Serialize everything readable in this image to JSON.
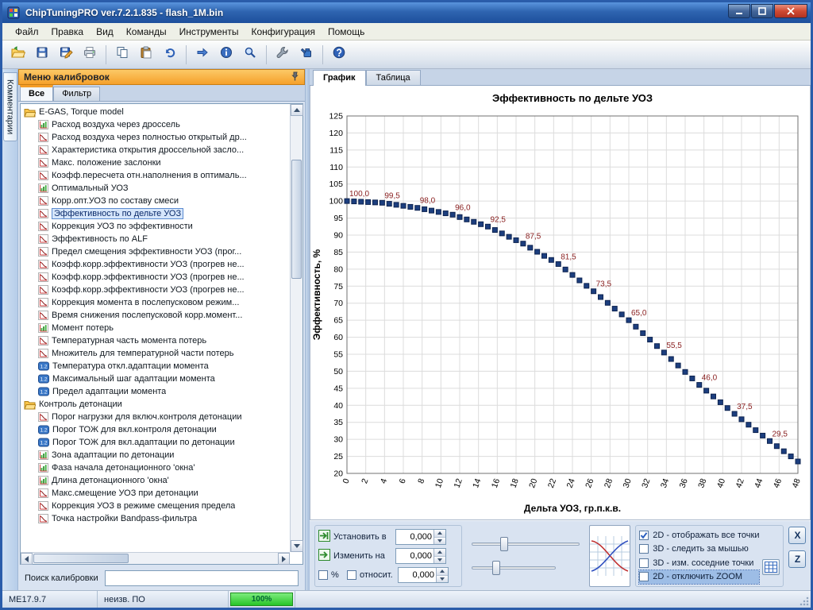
{
  "window": {
    "title": "ChipTuningPRO ver.7.2.1.835 - flash_1M.bin"
  },
  "menu": {
    "items": [
      "Файл",
      "Правка",
      "Вид",
      "Команды",
      "Инструменты",
      "Конфигурация",
      "Помощь"
    ]
  },
  "toolbar": {
    "items": [
      "open",
      "save",
      "save-edit",
      "print",
      "sep",
      "copy",
      "paste",
      "undo",
      "sep",
      "compare",
      "info",
      "search",
      "sep",
      "tools",
      "refill",
      "sep",
      "help"
    ]
  },
  "side_tab": {
    "label": "Комментарии"
  },
  "left_panel": {
    "header": "Меню калибровок",
    "tabs": [
      {
        "label": "Все",
        "active": true
      },
      {
        "label": "Фильтр",
        "active": false
      }
    ],
    "search_label": "Поиск калибровки",
    "tree": [
      {
        "label": "E-GAS, Torque model",
        "items": [
          {
            "icon": "map",
            "label": "Расход воздуха через дроссель"
          },
          {
            "icon": "curve",
            "label": "Расход воздуха через полностью открытый др..."
          },
          {
            "icon": "curve",
            "label": "Характеристика открытия дроссельной засло..."
          },
          {
            "icon": "curve",
            "label": "Макс. положение заслонки"
          },
          {
            "icon": "curve",
            "label": "Коэфф.пересчета отн.наполнения в оптималь..."
          },
          {
            "icon": "map",
            "label": "Оптимальный УОЗ"
          },
          {
            "icon": "curve",
            "label": "Корр.опт.УОЗ по составу смеси"
          },
          {
            "icon": "curve",
            "label": "Эффективность по дельте УОЗ",
            "selected": true
          },
          {
            "icon": "curve",
            "label": "Коррекция УОЗ по эффективности"
          },
          {
            "icon": "curve",
            "label": "Эффективность по ALF"
          },
          {
            "icon": "curve",
            "label": "Предел смещения эффективности УОЗ (прог..."
          },
          {
            "icon": "curve",
            "label": "Коэфф.корр.эффективности УОЗ (прогрев не..."
          },
          {
            "icon": "curve",
            "label": "Коэфф.корр.эффективности УОЗ (прогрев не..."
          },
          {
            "icon": "curve",
            "label": "Коэфф.корр.эффективности УОЗ (прогрев не..."
          },
          {
            "icon": "curve",
            "label": "Коррекция момента в послепусковом режим..."
          },
          {
            "icon": "curve",
            "label": "Время снижения послепусковой корр.момент..."
          },
          {
            "icon": "map",
            "label": "Момент потерь"
          },
          {
            "icon": "curve",
            "label": "Температурная часть момента потерь"
          },
          {
            "icon": "curve",
            "label": "Множитель для температурной части потерь"
          },
          {
            "icon": "scalar",
            "label": "Температура откл.адаптации момента"
          },
          {
            "icon": "scalar",
            "label": "Максимальный шаг адаптации момента"
          },
          {
            "icon": "scalar",
            "label": "Предел адаптации момента"
          }
        ]
      },
      {
        "label": "Контроль детонации",
        "items": [
          {
            "icon": "curve",
            "label": "Порог нагрузки для включ.контроля детонации"
          },
          {
            "icon": "scalar",
            "label": "Порог ТОЖ для вкл.контроля детонации"
          },
          {
            "icon": "scalar",
            "label": "Порог ТОЖ для вкл.адаптации по детонации"
          },
          {
            "icon": "map",
            "label": "Зона адаптации по детонации"
          },
          {
            "icon": "map",
            "label": "Фаза начала детонационного 'окна'"
          },
          {
            "icon": "map",
            "label": "Длина детонационного 'окна'"
          },
          {
            "icon": "curve",
            "label": "Макс.смещение УОЗ при детонации"
          },
          {
            "icon": "curve",
            "label": "Коррекция УОЗ в режиме смещения предела"
          },
          {
            "icon": "curve",
            "label": "Точка настройки Bandpass-фильтра"
          }
        ]
      }
    ]
  },
  "right_panel": {
    "tabs": [
      {
        "label": "График",
        "active": true
      },
      {
        "label": "Таблица",
        "active": false
      }
    ]
  },
  "controls": {
    "set_label": "Установить в",
    "set_value": "0,000",
    "change_label": "Изменить на",
    "change_value": "0,000",
    "percent_label": "%",
    "relative_label": "относит.",
    "relative_value": "0,000",
    "checkboxes": [
      {
        "label": "2D - отображать все точки",
        "checked": true,
        "highlighted": false
      },
      {
        "label": "3D - следить за мышью",
        "checked": false,
        "highlighted": false
      },
      {
        "label": "3D - изм. соседние точки",
        "checked": false,
        "highlighted": false
      },
      {
        "label": "2D - отключить ZOOM",
        "checked": false,
        "highlighted": true
      }
    ],
    "buttons": [
      {
        "label": "X"
      },
      {
        "label": "Z"
      }
    ]
  },
  "status_bar": {
    "ecu": "ME17.9.7",
    "software": "неизв. ПО",
    "progress": "100%"
  },
  "chart_data": {
    "type": "scatter",
    "title": "Эффективность по дельте УОЗ",
    "xlabel": "Дельта УОЗ, гр.п.к.в.",
    "ylabel": "Эффективность, %",
    "xlim": [
      0,
      48
    ],
    "ylim": [
      20,
      125
    ],
    "x_tick_step": 2,
    "y_tick_step": 5,
    "x_step": 0.75,
    "grid": true,
    "label_every": 5,
    "marker_color": "#1c3e7e",
    "marker_edge_color": "#0e2450",
    "label_color": "#8b2222",
    "grid_color": "#dcdcdc",
    "values": [
      100.0,
      99.9,
      99.8,
      99.7,
      99.6,
      99.5,
      99.2,
      98.9,
      98.6,
      98.3,
      98.0,
      97.6,
      97.2,
      96.8,
      96.4,
      96.0,
      95.3,
      94.6,
      93.9,
      93.2,
      92.5,
      91.5,
      90.5,
      89.5,
      88.5,
      87.5,
      86.3,
      85.1,
      83.9,
      82.7,
      81.5,
      79.9,
      78.3,
      76.7,
      75.1,
      73.5,
      71.8,
      70.1,
      68.4,
      66.7,
      65.0,
      63.1,
      61.2,
      59.3,
      57.4,
      55.5,
      53.6,
      51.7,
      49.8,
      47.9,
      46.0,
      44.3,
      42.6,
      40.9,
      39.2,
      37.5,
      35.9,
      34.3,
      32.7,
      31.1,
      29.5,
      28.0,
      26.5,
      25.0,
      23.5
    ]
  }
}
